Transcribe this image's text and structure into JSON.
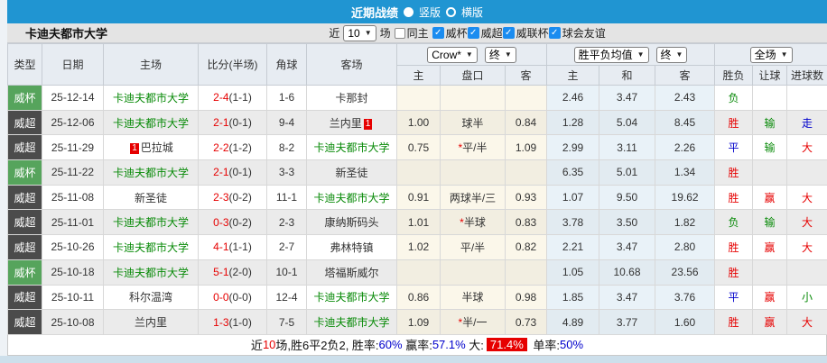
{
  "topbar": {
    "title": "近期战绩",
    "vertical_label": "竖版",
    "horizontal_label": "横版"
  },
  "filter": {
    "team": "卡迪夫都市大学",
    "recent_label": "近",
    "recent_value": "10",
    "matches_label": "场",
    "same_home_label": "同主",
    "leagues": [
      "威杯",
      "威超",
      "威联杯",
      "球会友谊"
    ]
  },
  "table": {
    "left_headers": [
      "类型",
      "日期",
      "主场",
      "比分(半场)",
      "角球",
      "客场"
    ],
    "dropdowns": {
      "handicap_company": "Crow*",
      "handicap_state": "终",
      "odds_type": "胜平负均值",
      "odds_state": "终",
      "scope": "全场"
    },
    "sub_headers": [
      "主",
      "盘口",
      "客",
      "主",
      "和",
      "客",
      "胜负",
      "让球",
      "进球数"
    ],
    "rows": [
      {
        "type": "威杯",
        "type_style": "green",
        "date": "25-12-14",
        "home": "卡迪夫都市大学",
        "home_is_subject": true,
        "home_badge": "",
        "home_badge_pos": "",
        "score": "2-4",
        "half": "(1-1)",
        "corner": "1-6",
        "away": "卡那封",
        "away_is_subject": false,
        "away_badge": "",
        "away_badge_pos": "",
        "ah_home": "",
        "ah_line": "",
        "ah_star": false,
        "ah_away": "",
        "odds_home": "2.46",
        "odds_draw": "3.47",
        "odds_away": "2.43",
        "wdl": "负",
        "wdl_color": "green",
        "ah_result": "",
        "ah_result_color": "",
        "goals": "",
        "goals_color": ""
      },
      {
        "type": "威超",
        "type_style": "dark",
        "date": "25-12-06",
        "home": "卡迪夫都市大学",
        "home_is_subject": true,
        "home_badge": "",
        "home_badge_pos": "",
        "score": "2-1",
        "half": "(0-1)",
        "corner": "9-4",
        "away": "兰内里",
        "away_is_subject": false,
        "away_badge": "1",
        "away_badge_pos": "after",
        "ah_home": "1.00",
        "ah_line": "球半",
        "ah_star": false,
        "ah_away": "0.84",
        "odds_home": "1.28",
        "odds_draw": "5.04",
        "odds_away": "8.45",
        "wdl": "胜",
        "wdl_color": "red",
        "ah_result": "输",
        "ah_result_color": "green",
        "goals": "走",
        "goals_color": "blue"
      },
      {
        "type": "威超",
        "type_style": "dark",
        "date": "25-11-29",
        "home": "巴拉城",
        "home_is_subject": false,
        "home_badge": "1",
        "home_badge_pos": "before",
        "score": "2-2",
        "half": "(1-2)",
        "corner": "8-2",
        "away": "卡迪夫都市大学",
        "away_is_subject": true,
        "away_badge": "",
        "away_badge_pos": "",
        "ah_home": "0.75",
        "ah_line": "平/半",
        "ah_star": true,
        "ah_away": "1.09",
        "odds_home": "2.99",
        "odds_draw": "3.11",
        "odds_away": "2.26",
        "wdl": "平",
        "wdl_color": "blue",
        "ah_result": "输",
        "ah_result_color": "green",
        "goals": "大",
        "goals_color": "red"
      },
      {
        "type": "威杯",
        "type_style": "green",
        "date": "25-11-22",
        "home": "卡迪夫都市大学",
        "home_is_subject": true,
        "home_badge": "",
        "home_badge_pos": "",
        "score": "2-1",
        "half": "(0-1)",
        "corner": "3-3",
        "away": "新圣徒",
        "away_is_subject": false,
        "away_badge": "",
        "away_badge_pos": "",
        "ah_home": "",
        "ah_line": "",
        "ah_star": false,
        "ah_away": "",
        "odds_home": "6.35",
        "odds_draw": "5.01",
        "odds_away": "1.34",
        "wdl": "胜",
        "wdl_color": "red",
        "ah_result": "",
        "ah_result_color": "",
        "goals": "",
        "goals_color": ""
      },
      {
        "type": "威超",
        "type_style": "dark",
        "date": "25-11-08",
        "home": "新圣徒",
        "home_is_subject": false,
        "home_badge": "",
        "home_badge_pos": "",
        "score": "2-3",
        "half": "(0-2)",
        "corner": "11-1",
        "away": "卡迪夫都市大学",
        "away_is_subject": true,
        "away_badge": "",
        "away_badge_pos": "",
        "ah_home": "0.91",
        "ah_line": "两球半/三",
        "ah_star": false,
        "ah_away": "0.93",
        "odds_home": "1.07",
        "odds_draw": "9.50",
        "odds_away": "19.62",
        "wdl": "胜",
        "wdl_color": "red",
        "ah_result": "赢",
        "ah_result_color": "red",
        "goals": "大",
        "goals_color": "red"
      },
      {
        "type": "威超",
        "type_style": "dark",
        "date": "25-11-01",
        "home": "卡迪夫都市大学",
        "home_is_subject": true,
        "home_badge": "",
        "home_badge_pos": "",
        "score": "0-3",
        "half": "(0-2)",
        "corner": "2-3",
        "away": "康纳斯码头",
        "away_is_subject": false,
        "away_badge": "",
        "away_badge_pos": "",
        "ah_home": "1.01",
        "ah_line": "半球",
        "ah_star": true,
        "ah_away": "0.83",
        "odds_home": "3.78",
        "odds_draw": "3.50",
        "odds_away": "1.82",
        "wdl": "负",
        "wdl_color": "green",
        "ah_result": "输",
        "ah_result_color": "green",
        "goals": "大",
        "goals_color": "red"
      },
      {
        "type": "威超",
        "type_style": "dark",
        "date": "25-10-26",
        "home": "卡迪夫都市大学",
        "home_is_subject": true,
        "home_badge": "",
        "home_badge_pos": "",
        "score": "4-1",
        "half": "(1-1)",
        "corner": "2-7",
        "away": "弗林特镇",
        "away_is_subject": false,
        "away_badge": "",
        "away_badge_pos": "",
        "ah_home": "1.02",
        "ah_line": "平/半",
        "ah_star": false,
        "ah_away": "0.82",
        "odds_home": "2.21",
        "odds_draw": "3.47",
        "odds_away": "2.80",
        "wdl": "胜",
        "wdl_color": "red",
        "ah_result": "赢",
        "ah_result_color": "red",
        "goals": "大",
        "goals_color": "red"
      },
      {
        "type": "威杯",
        "type_style": "green",
        "date": "25-10-18",
        "home": "卡迪夫都市大学",
        "home_is_subject": true,
        "home_badge": "",
        "home_badge_pos": "",
        "score": "5-1",
        "half": "(2-0)",
        "corner": "10-1",
        "away": "塔福斯威尔",
        "away_is_subject": false,
        "away_badge": "",
        "away_badge_pos": "",
        "ah_home": "",
        "ah_line": "",
        "ah_star": false,
        "ah_away": "",
        "odds_home": "1.05",
        "odds_draw": "10.68",
        "odds_away": "23.56",
        "wdl": "胜",
        "wdl_color": "red",
        "ah_result": "",
        "ah_result_color": "",
        "goals": "",
        "goals_color": ""
      },
      {
        "type": "威超",
        "type_style": "dark",
        "date": "25-10-11",
        "home": "科尔温湾",
        "home_is_subject": false,
        "home_badge": "",
        "home_badge_pos": "",
        "score": "0-0",
        "half": "(0-0)",
        "corner": "12-4",
        "away": "卡迪夫都市大学",
        "away_is_subject": true,
        "away_badge": "",
        "away_badge_pos": "",
        "ah_home": "0.86",
        "ah_line": "半球",
        "ah_star": false,
        "ah_away": "0.98",
        "odds_home": "1.85",
        "odds_draw": "3.47",
        "odds_away": "3.76",
        "wdl": "平",
        "wdl_color": "blue",
        "ah_result": "赢",
        "ah_result_color": "red",
        "goals": "小",
        "goals_color": "green"
      },
      {
        "type": "威超",
        "type_style": "dark",
        "date": "25-10-08",
        "home": "兰内里",
        "home_is_subject": false,
        "home_badge": "",
        "home_badge_pos": "",
        "score": "1-3",
        "half": "(1-0)",
        "corner": "7-5",
        "away": "卡迪夫都市大学",
        "away_is_subject": true,
        "away_badge": "",
        "away_badge_pos": "",
        "ah_home": "1.09",
        "ah_line": "半/一",
        "ah_star": true,
        "ah_away": "0.73",
        "odds_home": "4.89",
        "odds_draw": "3.77",
        "odds_away": "1.60",
        "wdl": "胜",
        "wdl_color": "red",
        "ah_result": "赢",
        "ah_result_color": "red",
        "goals": "大",
        "goals_color": "red"
      }
    ]
  },
  "summary": {
    "prefix": "近",
    "count": "10",
    "stats": "场,胜6平2负2, 胜率:",
    "win_rate": "60%",
    "mid1": " 赢率:",
    "cover_rate": "57.1%",
    "mid2": " 大:",
    "big_rate": "71.4%",
    "mid3": " 单率:",
    "odd_rate": "50%"
  },
  "colors": {
    "topbar_blue": "#2095d2",
    "type_green": "#56a45c",
    "type_dark": "#4b4b4b",
    "team_green": "#088a08",
    "result_red": "#e60000",
    "result_blue": "#0000cc",
    "handicap_bg": "#fbf7ea",
    "odds_bg": "#e9f2f8",
    "checkbox_blue": "#1b8cf0"
  }
}
